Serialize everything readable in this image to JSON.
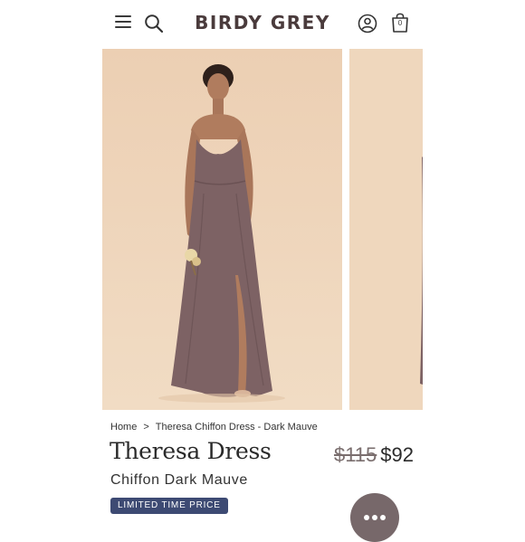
{
  "header": {
    "logo": "BIRDY GREY",
    "bag_count": "0",
    "icons": {
      "menu": "hamburger-menu-icon",
      "search": "search-icon",
      "account": "user-icon",
      "bag": "shopping-bag-icon"
    }
  },
  "gallery": {
    "slides": [
      "product-photo",
      "product-photo"
    ],
    "background_color": "#efd7bd",
    "dress_color": "#7d6264"
  },
  "breadcrumb": {
    "home": "Home",
    "separator": ">",
    "current": "Theresa Chiffon Dress - Dark Mauve"
  },
  "product": {
    "title": "Theresa Dress",
    "subtitle": "Chiffon Dark Mauve",
    "old_price": "$115",
    "price": "$92",
    "badge": "LIMITED TIME PRICE",
    "badge_color": "#3d4a73"
  },
  "chat": {
    "icon": "chat-dots-icon",
    "color": "#77686a"
  }
}
